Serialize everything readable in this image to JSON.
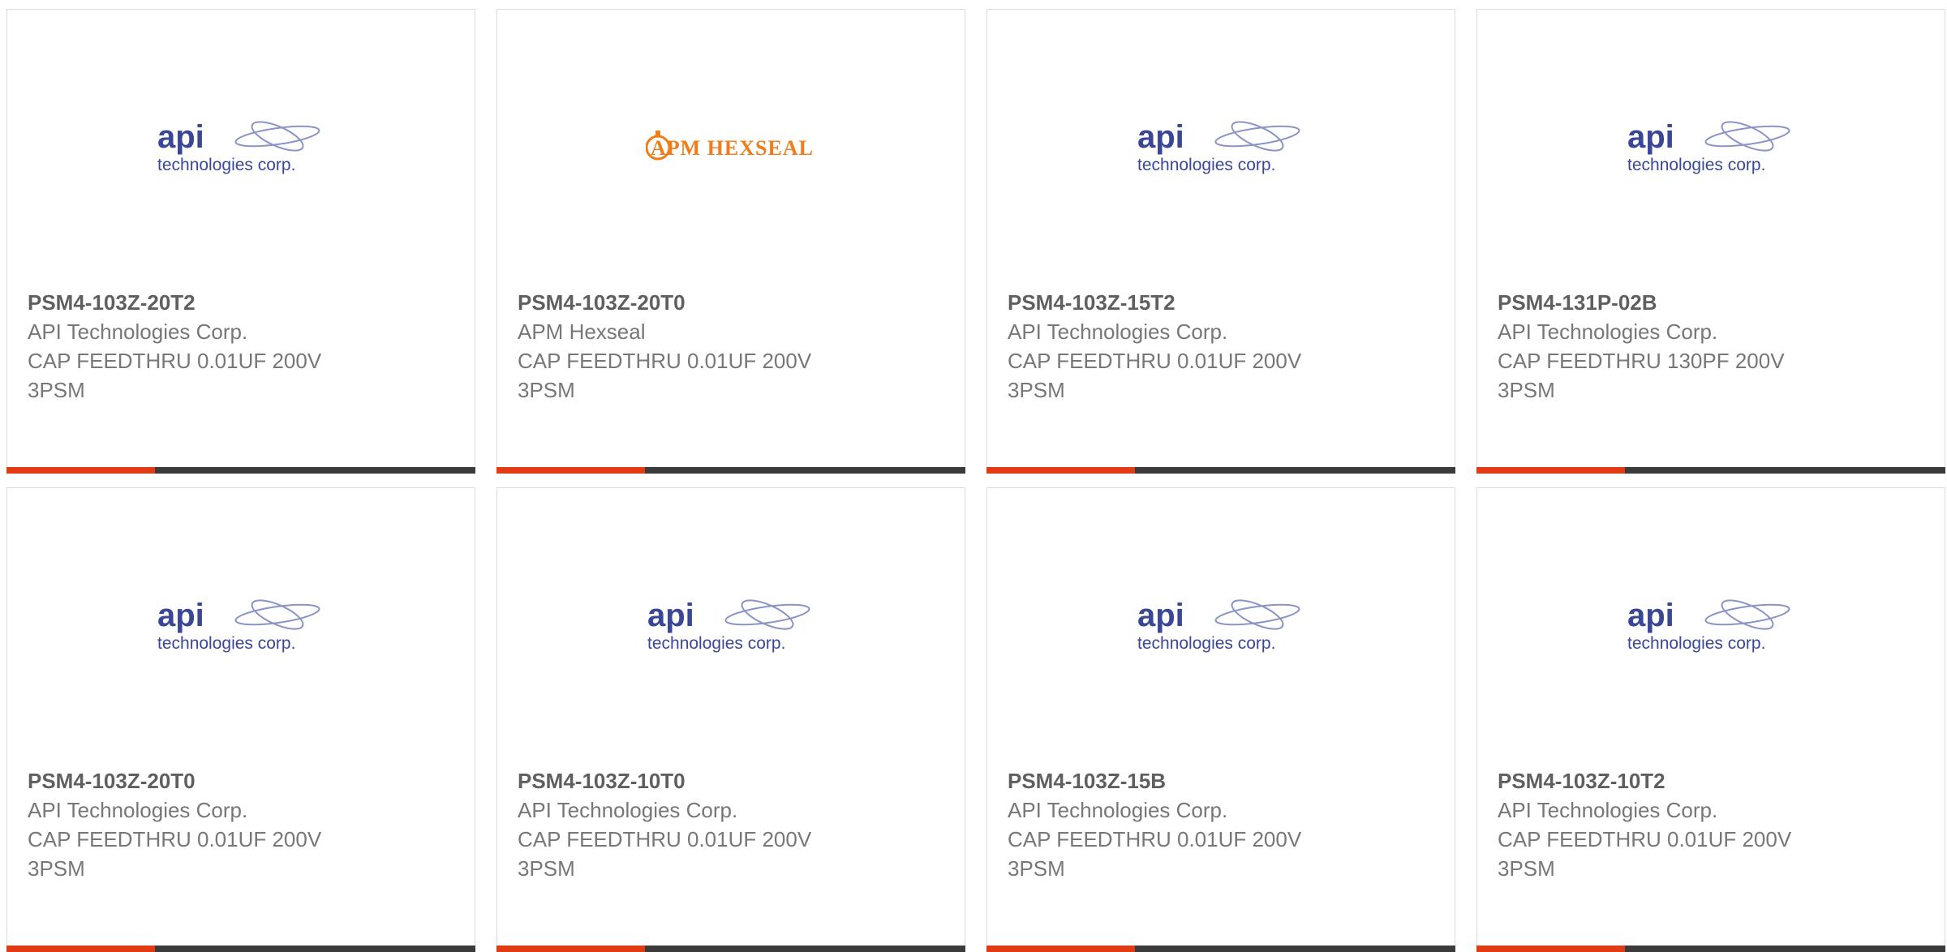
{
  "colors": {
    "api_blue": "#3a4797",
    "hexseal_orange": "#ef7d1a",
    "bar_accent": "#e23a12",
    "bar_dark": "#3b3b3b",
    "text_gray": "#777777"
  },
  "products": [
    {
      "part_number": "PSM4-103Z-20T2",
      "manufacturer": "API Technologies Corp.",
      "description": "CAP FEEDTHRU 0.01UF 200V",
      "package": "3PSM",
      "logo": "api",
      "logo_text": "api",
      "logo_subtext": "technologies corp."
    },
    {
      "part_number": "PSM4-103Z-20T0",
      "manufacturer": "APM Hexseal",
      "description": "CAP FEEDTHRU 0.01UF 200V",
      "package": "3PSM",
      "logo": "hexseal",
      "logo_text": "APM HEXSEAL",
      "logo_subtext": ""
    },
    {
      "part_number": "PSM4-103Z-15T2",
      "manufacturer": "API Technologies Corp.",
      "description": "CAP FEEDTHRU 0.01UF 200V",
      "package": "3PSM",
      "logo": "api",
      "logo_text": "api",
      "logo_subtext": "technologies corp."
    },
    {
      "part_number": "PSM4-131P-02B",
      "manufacturer": "API Technologies Corp.",
      "description": "CAP FEEDTHRU 130PF 200V",
      "package": "3PSM",
      "logo": "api",
      "logo_text": "api",
      "logo_subtext": "technologies corp."
    },
    {
      "part_number": "PSM4-103Z-20T0",
      "manufacturer": "API Technologies Corp.",
      "description": "CAP FEEDTHRU 0.01UF 200V",
      "package": "3PSM",
      "logo": "api",
      "logo_text": "api",
      "logo_subtext": "technologies corp."
    },
    {
      "part_number": "PSM4-103Z-10T0",
      "manufacturer": "API Technologies Corp.",
      "description": "CAP FEEDTHRU 0.01UF 200V",
      "package": "3PSM",
      "logo": "api",
      "logo_text": "api",
      "logo_subtext": "technologies corp."
    },
    {
      "part_number": "PSM4-103Z-15B",
      "manufacturer": "API Technologies Corp.",
      "description": "CAP FEEDTHRU 0.01UF 200V",
      "package": "3PSM",
      "logo": "api",
      "logo_text": "api",
      "logo_subtext": "technologies corp."
    },
    {
      "part_number": "PSM4-103Z-10T2",
      "manufacturer": "API Technologies Corp.",
      "description": "CAP FEEDTHRU 0.01UF 200V",
      "package": "3PSM",
      "logo": "api",
      "logo_text": "api",
      "logo_subtext": "technologies corp."
    }
  ]
}
